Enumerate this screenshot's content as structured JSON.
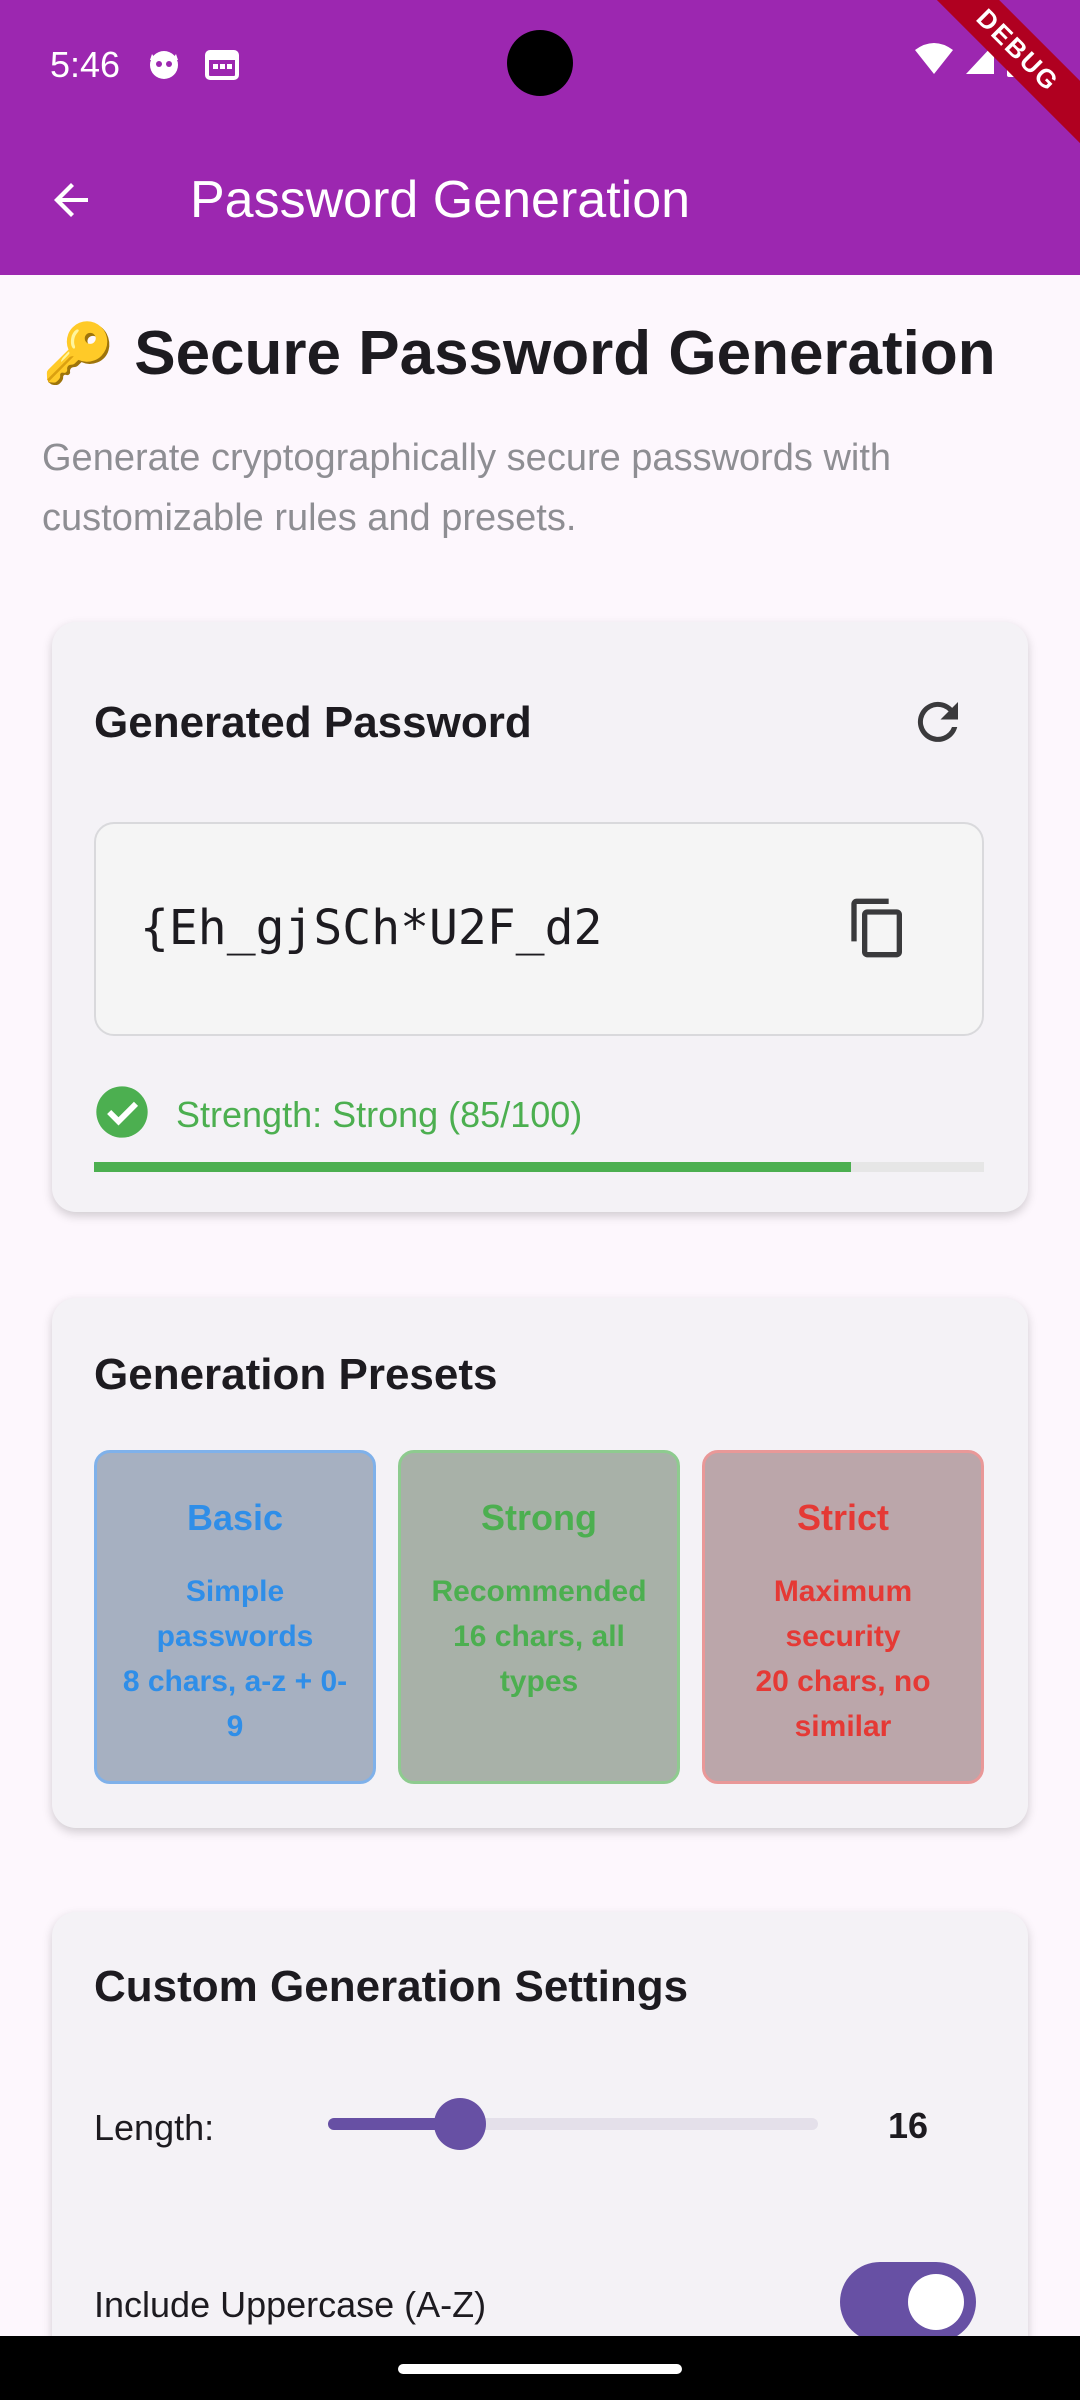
{
  "status_bar": {
    "time": "5:46",
    "debug_label": "DEBUG",
    "icons": [
      "cat-notification-icon",
      "calendar-icon",
      "wifi-icon",
      "signal-icon",
      "battery-icon"
    ]
  },
  "app_bar": {
    "title": "Password Generation",
    "back_icon": "arrow-back-icon",
    "color": "#9c27b0"
  },
  "header": {
    "emoji": "🔑",
    "title": "Secure Password Generation",
    "subtitle": "Generate cryptographically secure passwords with customizable rules and presets."
  },
  "generated_card": {
    "title": "Generated Password",
    "password": "{Eh_gjSCh*U2F_d2",
    "strength_text": "Strength: Strong (85/100)",
    "strength_score": 85,
    "strength_color": "#4caf50",
    "refresh_icon": "refresh-icon",
    "copy_icon": "copy-icon"
  },
  "presets_card": {
    "title": "Generation Presets",
    "presets": [
      {
        "name": "Basic",
        "line1": "Simple passwords",
        "line2": "8 chars, a-z + 0-9",
        "color": "#2f8ee8"
      },
      {
        "name": "Strong",
        "line1": "Recommended",
        "line2": "16 chars, all types",
        "color": "#4caf50"
      },
      {
        "name": "Strict",
        "line1": "Maximum security",
        "line2": "20 chars, no similar",
        "color": "#e53935"
      }
    ]
  },
  "custom_card": {
    "title": "Custom Generation Settings",
    "length_label": "Length:",
    "length_value": "16",
    "length_fraction": 0.27,
    "uppercase_label": "Include Uppercase (A-Z)",
    "uppercase_enabled": true,
    "accent": "#6750a4"
  }
}
